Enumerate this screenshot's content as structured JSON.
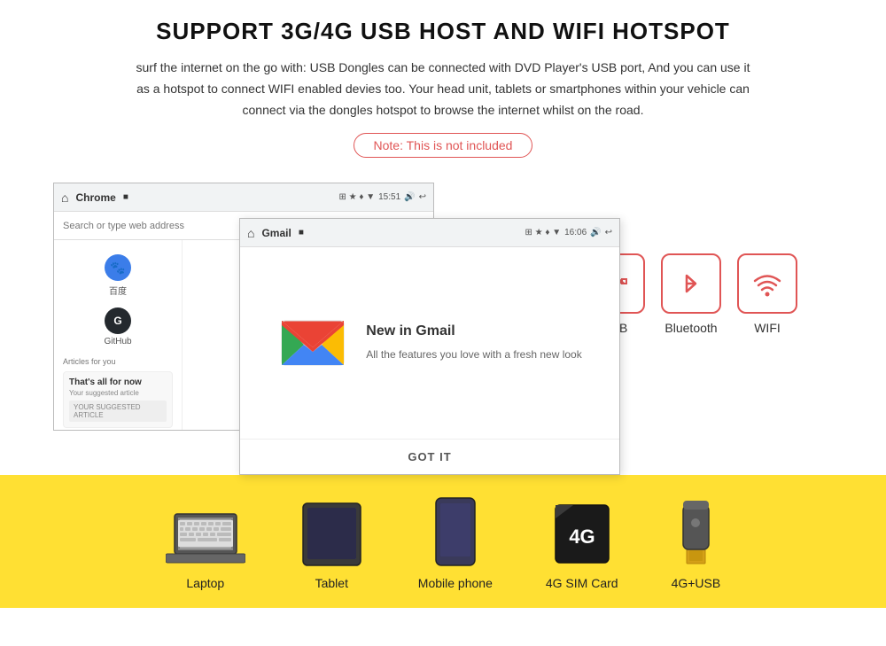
{
  "header": {
    "title": "SUPPORT 3G/4G USB HOST AND WIFI HOTSPOT",
    "description": "surf the internet on the go with: USB Dongles can be connected with DVD Player's USB port, And you can use it as a hotspot to connect WIFI enabled devies too. Your head unit, tablets or smartphones within your vehicle can connect via the dongles hotspot to browse the internet whilst on the road.",
    "note": "Note: This is not included"
  },
  "chrome_screen": {
    "tab_label": "Chrome",
    "time": "15:51",
    "search_placeholder": "Search or type web address",
    "apps": [
      {
        "name": "百度",
        "icon": "🐾",
        "bg": "#3b7de9"
      },
      {
        "name": "GitHub",
        "icon": "G",
        "bg": "#24292e"
      }
    ],
    "articles_label": "Articles for you",
    "suggestion_title": "That's all for now",
    "suggestion_sub": "Your suggested article",
    "suggestion_more": "YOUR SUGGESTED ARTICLE"
  },
  "gmail_screen": {
    "tab_label": "Gmail",
    "time": "16:06",
    "new_title": "New in Gmail",
    "sub_text": "All the features you love with a fresh new look",
    "got_it": "GOT IT"
  },
  "icons": [
    {
      "id": "usb",
      "label": "USB",
      "symbol": "⚡"
    },
    {
      "id": "bluetooth",
      "label": "Bluetooth",
      "symbol": "✱"
    },
    {
      "id": "wifi",
      "label": "WIFI",
      "symbol": "📶"
    }
  ],
  "devices": [
    {
      "id": "laptop",
      "label": "Laptop"
    },
    {
      "id": "tablet",
      "label": "Tablet"
    },
    {
      "id": "mobile-phone",
      "label": "Mobile phone"
    },
    {
      "id": "sim-card",
      "label": "4G SIM Card"
    },
    {
      "id": "usb-dongle",
      "label": "4G+USB"
    }
  ]
}
